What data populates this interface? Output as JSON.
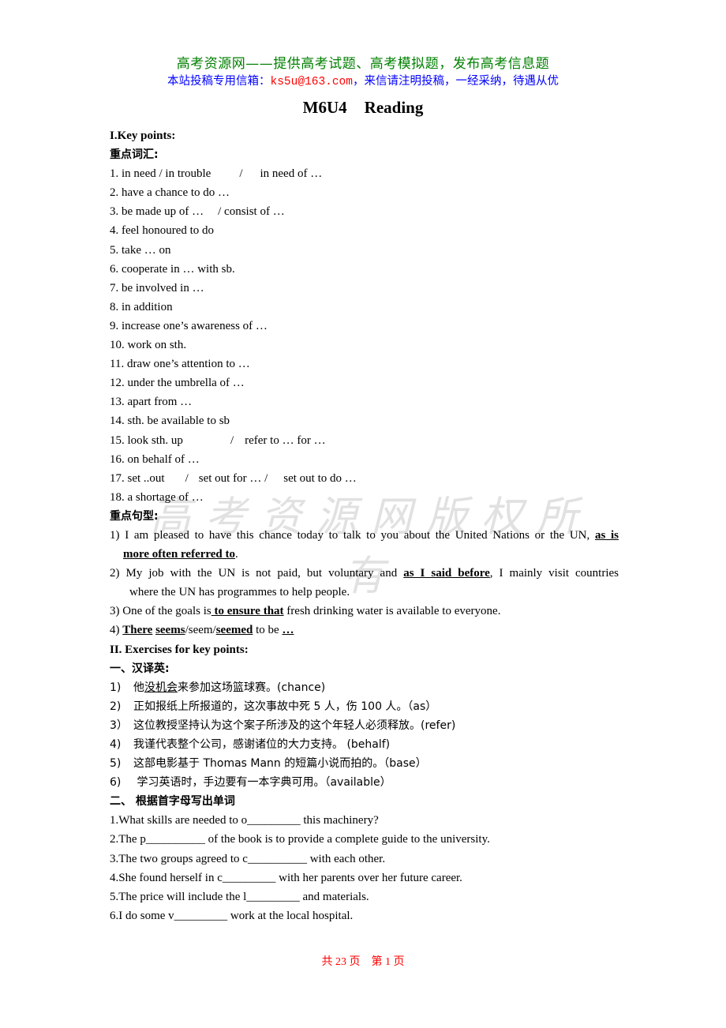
{
  "header": {
    "line1": "高考资源网——提供高考试题、高考模拟题，发布高考信息题",
    "line2_prefix": "本站投稿专用信箱：",
    "email": "ks5u@163.com",
    "line2_suffix": "，来信请注明投稿，一经采纳，待遇从优"
  },
  "title": {
    "code": "M6U4",
    "word": "Reading"
  },
  "watermark": "高考资源网版权所有",
  "section1": {
    "heading": "I.Key points:",
    "vocab_heading": "重点词汇:",
    "vocab": [
      {
        "a": "1. in need / in trouble",
        "b": "/",
        "c": "in need of …"
      },
      {
        "a": "2. have a chance to do …"
      },
      {
        "a": "3. be made up of …",
        "b": "/ consist of …"
      },
      {
        "a": "4. feel honoured to do"
      },
      {
        "a": "5. take … on"
      },
      {
        "a": "6. cooperate in … with sb."
      },
      {
        "a": "7. be involved in …"
      },
      {
        "a": "8. in addition"
      },
      {
        "a": "9. increase one’s awareness of …"
      },
      {
        "a": "10. work on sth."
      },
      {
        "a": "11. draw one’s attention to …"
      },
      {
        "a": "12. under the umbrella of …"
      },
      {
        "a": "13. apart from …"
      },
      {
        "a": "14. sth. be available to sb"
      },
      {
        "a": "15. look sth. up",
        "b": "/",
        "c": "refer to … for …"
      },
      {
        "a": "16. on behalf of …"
      },
      {
        "a": "17. set ..out",
        "b": "/",
        "c": "set out for … /",
        "d": "set out to do …"
      },
      {
        "a": "18. a shortage of …"
      }
    ],
    "patterns_heading": "重点句型:",
    "patterns": {
      "p1_a": "1) I am pleased to have this chance today to talk to you about the United Nations or the UN, ",
      "p1_b": "as is",
      "p1_c": "more often referred to",
      "p1_d": ".",
      "p2_a": "2) My job with the UN is not paid, but voluntary and ",
      "p2_b": "as I said before",
      "p2_c": ", I mainly visit countries",
      "p2_d": "where the UN has programmes to help people.",
      "p3_a": "3) One of the goals is",
      "p3_b": " to ensure that",
      "p3_c": " fresh drinking water is available to everyone.",
      "p4_a": "4) ",
      "p4_b": "There",
      "p4_c": "seems",
      "p4_d": "/seem/",
      "p4_e": "seemed",
      "p4_f": " to be ",
      "p4_g": "…"
    }
  },
  "section2": {
    "heading": "II. Exercises for key points:",
    "translate_heading": "一、汉译英:",
    "translate": [
      {
        "n": "1)",
        "pre": "他",
        "u": "没机会",
        "post": "来参加这场篮球赛。(chance)"
      },
      {
        "n": "2)",
        "pre": "正如报纸上所报道的，这次事故中死 5 人，伤 100 人。（as）"
      },
      {
        "n": "3）",
        "pre": "这位教授坚持认为这个案子所涉及的这个年轻人必须释放。(refer)"
      },
      {
        "n": "4)",
        "pre": "我谨代表整个公司，感谢诸位的大力支持。 (behalf)"
      },
      {
        "n": "5)",
        "pre": "这部电影基于 Thomas Mann  的短篇小说而拍的。（base）"
      },
      {
        "n": "6)",
        "pre": " 学习英语时，手边要有一本字典可用。（available）"
      }
    ],
    "fill_heading": "二、  根据首字母写出单词",
    "fill": [
      "1.What skills are needed to o_________ this machinery?",
      "2.The p__________ of the book is to provide a complete guide to the university.",
      "3.The two groups agreed to c__________ with each other.",
      "4.She found herself in c_________ with her parents over her future career.",
      "5.The price will include the l_________ and materials.",
      "6.I do some v_________ work at the local hospital."
    ]
  },
  "footer": {
    "total": "共 23 页",
    "page": "第 1 页"
  }
}
